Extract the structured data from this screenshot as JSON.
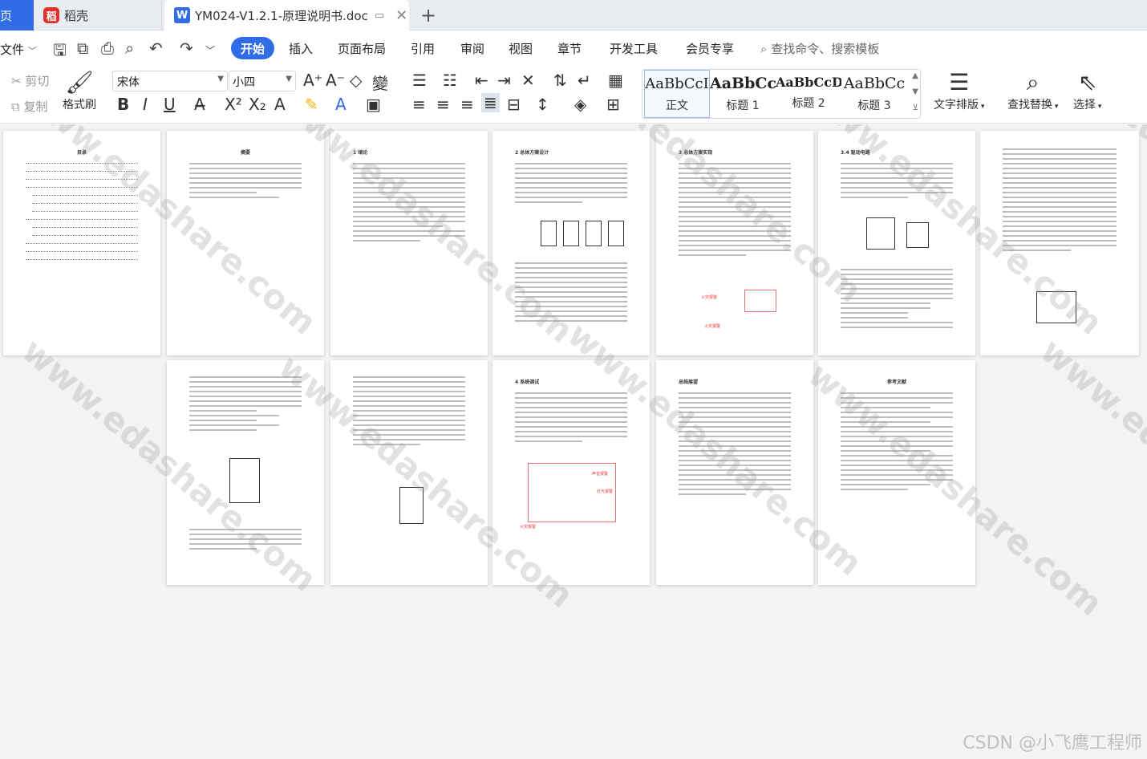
{
  "tabs": {
    "home_label": "页",
    "daoke_label": "稻壳",
    "doc_label": "YM024-V1.2.1-原理说明书.doc",
    "add_label": "+"
  },
  "menu": {
    "file": "文件",
    "items": [
      "开始",
      "插入",
      "页面布局",
      "引用",
      "审阅",
      "视图",
      "章节",
      "开发工具",
      "会员专享"
    ],
    "search_placeholder": "查找命令、搜索模板"
  },
  "ribbon": {
    "cut": "剪切",
    "copy": "复制",
    "format_painter": "格式刷",
    "font_name": "宋体",
    "font_size": "小四",
    "styles": [
      {
        "sample": "AaBbCcI",
        "name": "正文"
      },
      {
        "sample": "AaBbCcI",
        "name": "标题 1"
      },
      {
        "sample": "AaBbCcD",
        "name": "标题 2"
      },
      {
        "sample": "AaBbCc",
        "name": "标题 3"
      }
    ],
    "text_layout": "文字排版",
    "find_replace": "查找替换",
    "select": "选择"
  },
  "pages_row1": [
    {
      "title": "目录"
    },
    {
      "title": "摘要"
    },
    {
      "title": "1 绪论"
    },
    {
      "title": "2 总体方案设计"
    },
    {
      "title": "3 总体方案实现"
    },
    {
      "title": "3.4 驱动电路"
    },
    {
      "title": ""
    }
  ],
  "pages_row2": [
    {
      "title": ""
    },
    {
      "title": ""
    },
    {
      "title": "4 系统调试"
    },
    {
      "title": "总结展望"
    },
    {
      "title": "参考文献"
    }
  ],
  "diagram_labels": {
    "fire_alarm": "火灾报警",
    "sound_alarm": "声音报警",
    "light_alarm": "灯光报警",
    "fire_alarm_2": "火灾报警"
  },
  "watermark": "www.edashare.com",
  "footer_credit": "CSDN @小飞鹰工程师"
}
